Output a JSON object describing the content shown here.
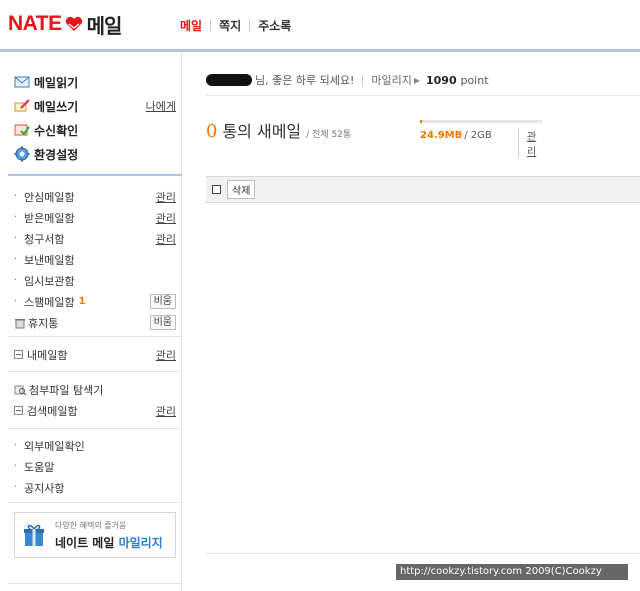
{
  "header": {
    "logo_text": "NATE",
    "logo_service": "메일",
    "nav": [
      {
        "label": "메일",
        "active": true
      },
      {
        "label": "쪽지",
        "active": false
      },
      {
        "label": "주소록",
        "active": false
      }
    ]
  },
  "sidebar": {
    "main_menu": [
      {
        "label": "메일읽기",
        "icon": "read-mail-icon"
      },
      {
        "label": "메일쓰기",
        "icon": "write-mail-icon",
        "link": "나에게"
      },
      {
        "label": "수신확인",
        "icon": "receipt-check-icon"
      },
      {
        "label": "환경설정",
        "icon": "settings-gear-icon"
      }
    ],
    "folders": [
      {
        "label": "안심메일함",
        "action": "관리"
      },
      {
        "label": "받은메일함",
        "action": "관리"
      },
      {
        "label": "청구서함",
        "action": "관리"
      },
      {
        "label": "보낸메일함"
      },
      {
        "label": "임시보관함"
      },
      {
        "label": "스팸메일함",
        "count": "1",
        "button": "비움"
      }
    ],
    "trash": {
      "label": "휴지통",
      "button": "비움"
    },
    "my_mailbox": {
      "label": "내메일함",
      "action": "관리"
    },
    "attachment_explorer": {
      "label": "첨부파일 탐색기"
    },
    "search_mailbox": {
      "label": "검색메일함",
      "action": "관리"
    },
    "extra": [
      {
        "label": "외부메일확인"
      },
      {
        "label": "도움말"
      },
      {
        "label": "공지사항"
      }
    ],
    "banner": {
      "small_text": "다양한 혜택의 즐거움",
      "big_text_a": "네이트 메일 ",
      "big_text_b": "마일리지"
    }
  },
  "main": {
    "greeting": "님, 좋은 하루 되세요!",
    "mileage_label": "마일리지",
    "points": "1090",
    "points_unit": "point",
    "new_count": "0",
    "new_label": "통의 새메일",
    "total_label": "/ 전체 52통",
    "quota_used": "24.9MB",
    "quota_total": "/ 2GB",
    "quota_fraction": 0.012,
    "quota_manage": "관리",
    "delete_button": "삭제",
    "watermark": "http://cookzy.tistory.com 2009(C)Cookzy"
  },
  "colors": {
    "brand_red": "#e8141c",
    "accent_orange": "#f07a00",
    "divider_blue": "#a7c4e6"
  }
}
